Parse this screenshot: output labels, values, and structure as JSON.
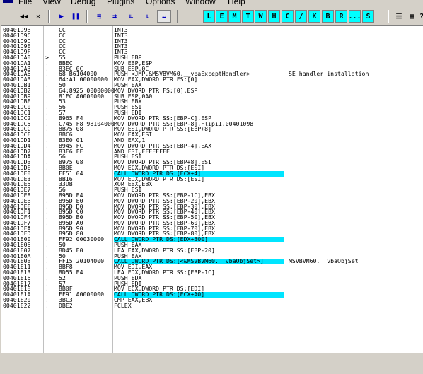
{
  "menu": [
    "File",
    "View",
    "Debug",
    "Plugins",
    "Options",
    "Window",
    "Help"
  ],
  "toolbar": {
    "nav_buttons": [
      "◀◀",
      "✕"
    ],
    "run_buttons": [
      "▶",
      "❚❚"
    ],
    "step_buttons": [
      "⇶",
      "⇉",
      "⇊",
      "⇓",
      "↵"
    ],
    "letter_buttons": [
      "L",
      "E",
      "M",
      "T",
      "W",
      "H",
      "C",
      "/",
      "K",
      "B",
      "R",
      "...",
      "S"
    ],
    "view_buttons": [
      "☰",
      "▦",
      "?"
    ]
  },
  "disasm": [
    {
      "addr": "00401D9B",
      "mark": "",
      "hex": "CC",
      "asm": "INT3",
      "hl": false,
      "comment": ""
    },
    {
      "addr": "00401D9C",
      "mark": "",
      "hex": "CC",
      "asm": "INT3",
      "hl": false,
      "comment": ""
    },
    {
      "addr": "00401D9D",
      "mark": "",
      "hex": "CC",
      "asm": "INT3",
      "hl": false,
      "comment": ""
    },
    {
      "addr": "00401D9E",
      "mark": "",
      "hex": "CC",
      "asm": "INT3",
      "hl": false,
      "comment": ""
    },
    {
      "addr": "00401D9F",
      "mark": "",
      "hex": "CC",
      "asm": "INT3",
      "hl": false,
      "comment": ""
    },
    {
      "addr": "00401DA0",
      "mark": ">",
      "hex": "55",
      "asm": "PUSH EBP",
      "hl": false,
      "comment": ""
    },
    {
      "addr": "00401DA1",
      "mark": ".",
      "hex": "8BEC",
      "asm": "MOV EBP,ESP",
      "hl": false,
      "comment": ""
    },
    {
      "addr": "00401DA3",
      "mark": ".",
      "hex": "83EC 0C",
      "asm": "SUB ESP,0C",
      "hl": false,
      "comment": ""
    },
    {
      "addr": "00401DA6",
      "mark": ".",
      "hex": "68 B6104000",
      "asm": "PUSH <JMP.&MSVBVM60.__vbaExceptHandler>",
      "hl": false,
      "comment": "SE handler installation"
    },
    {
      "addr": "00401DAB",
      "mark": ".",
      "hex": "64:A1 00000000",
      "asm": "MOV EAX,DWORD PTR FS:[0]",
      "hl": false,
      "comment": ""
    },
    {
      "addr": "00401DB1",
      "mark": ".",
      "hex": "50",
      "asm": "PUSH EAX",
      "hl": false,
      "comment": ""
    },
    {
      "addr": "00401DB2",
      "mark": ".",
      "hex": "64:8925 00000000",
      "asm": "MOV DWORD PTR FS:[0],ESP",
      "hl": false,
      "comment": ""
    },
    {
      "addr": "00401DB9",
      "mark": ".",
      "hex": "81EC A0000000",
      "asm": "SUB ESP,0A0",
      "hl": false,
      "comment": ""
    },
    {
      "addr": "00401DBF",
      "mark": ".",
      "hex": "53",
      "asm": "PUSH EBX",
      "hl": false,
      "comment": ""
    },
    {
      "addr": "00401DC0",
      "mark": ".",
      "hex": "56",
      "asm": "PUSH ESI",
      "hl": false,
      "comment": ""
    },
    {
      "addr": "00401DC1",
      "mark": ".",
      "hex": "57",
      "asm": "PUSH EDI",
      "hl": false,
      "comment": ""
    },
    {
      "addr": "00401DC2",
      "mark": ".",
      "hex": "8965 F4",
      "asm": "MOV DWORD PTR SS:[EBP-C],ESP",
      "hl": false,
      "comment": ""
    },
    {
      "addr": "00401DC5",
      "mark": ".",
      "hex": "C745 F8 98104000",
      "asm": "MOV DWORD PTR SS:[EBP-8],Flipi1.00401098",
      "hl": false,
      "comment": ""
    },
    {
      "addr": "00401DCC",
      "mark": ".",
      "hex": "8B75 08",
      "asm": "MOV ESI,DWORD PTR SS:[EBP+8]",
      "hl": false,
      "comment": ""
    },
    {
      "addr": "00401DCF",
      "mark": ".",
      "hex": "8BC6",
      "asm": "MOV EAX,ESI",
      "hl": false,
      "comment": ""
    },
    {
      "addr": "00401DD1",
      "mark": ".",
      "hex": "83E0 01",
      "asm": "AND EAX,1",
      "hl": false,
      "comment": ""
    },
    {
      "addr": "00401DD4",
      "mark": ".",
      "hex": "8945 FC",
      "asm": "MOV DWORD PTR SS:[EBP-4],EAX",
      "hl": false,
      "comment": ""
    },
    {
      "addr": "00401DD7",
      "mark": ".",
      "hex": "83E6 FE",
      "asm": "AND ESI,FFFFFFFE",
      "hl": false,
      "comment": ""
    },
    {
      "addr": "00401DDA",
      "mark": ".",
      "hex": "56",
      "asm": "PUSH ESI",
      "hl": false,
      "comment": ""
    },
    {
      "addr": "00401DDB",
      "mark": ".",
      "hex": "8975 08",
      "asm": "MOV DWORD PTR SS:[EBP+8],ESI",
      "hl": false,
      "comment": ""
    },
    {
      "addr": "00401DDE",
      "mark": ".",
      "hex": "8B0E",
      "asm": "MOV ECX,DWORD PTR DS:[ESI]",
      "hl": false,
      "comment": ""
    },
    {
      "addr": "00401DE0",
      "mark": ".",
      "hex": "FF51 04",
      "asm": "CALL DWORD PTR DS:[ECX+4]",
      "hl": true,
      "comment": ""
    },
    {
      "addr": "00401DE3",
      "mark": ".",
      "hex": "8B16",
      "asm": "MOV EDX,DWORD PTR DS:[ESI]",
      "hl": false,
      "comment": ""
    },
    {
      "addr": "00401DE5",
      "mark": ".",
      "hex": "33DB",
      "asm": "XOR EBX,EBX",
      "hl": false,
      "comment": ""
    },
    {
      "addr": "00401DE7",
      "mark": ".",
      "hex": "56",
      "asm": "PUSH ESI",
      "hl": false,
      "comment": ""
    },
    {
      "addr": "00401DE8",
      "mark": ".",
      "hex": "895D E4",
      "asm": "MOV DWORD PTR SS:[EBP-1C],EBX",
      "hl": false,
      "comment": ""
    },
    {
      "addr": "00401DEB",
      "mark": ".",
      "hex": "895D E0",
      "asm": "MOV DWORD PTR SS:[EBP-20],EBX",
      "hl": false,
      "comment": ""
    },
    {
      "addr": "00401DEE",
      "mark": ".",
      "hex": "895D D0",
      "asm": "MOV DWORD PTR SS:[EBP-30],EBX",
      "hl": false,
      "comment": ""
    },
    {
      "addr": "00401DF1",
      "mark": ".",
      "hex": "895D C0",
      "asm": "MOV DWORD PTR SS:[EBP-40],EBX",
      "hl": false,
      "comment": ""
    },
    {
      "addr": "00401DF4",
      "mark": ".",
      "hex": "895D B0",
      "asm": "MOV DWORD PTR SS:[EBP-50],EBX",
      "hl": false,
      "comment": ""
    },
    {
      "addr": "00401DF7",
      "mark": ".",
      "hex": "895D A0",
      "asm": "MOV DWORD PTR SS:[EBP-60],EBX",
      "hl": false,
      "comment": ""
    },
    {
      "addr": "00401DFA",
      "mark": ".",
      "hex": "895D 90",
      "asm": "MOV DWORD PTR SS:[EBP-70],EBX",
      "hl": false,
      "comment": ""
    },
    {
      "addr": "00401DFD",
      "mark": ".",
      "hex": "895D 80",
      "asm": "MOV DWORD PTR SS:[EBP-80],EBX",
      "hl": false,
      "comment": ""
    },
    {
      "addr": "00401E00",
      "mark": ".",
      "hex": "FF92 00030000",
      "asm": "CALL DWORD PTR DS:[EDX+300]",
      "hl": true,
      "comment": ""
    },
    {
      "addr": "00401E06",
      "mark": ".",
      "hex": "50",
      "asm": "PUSH EAX",
      "hl": false,
      "comment": ""
    },
    {
      "addr": "00401E07",
      "mark": ".",
      "hex": "8D45 E0",
      "asm": "LEA EAX,DWORD PTR SS:[EBP-20]",
      "hl": false,
      "comment": ""
    },
    {
      "addr": "00401E0A",
      "mark": ".",
      "hex": "50",
      "asm": "PUSH EAX",
      "hl": false,
      "comment": ""
    },
    {
      "addr": "00401E0B",
      "mark": ".",
      "hex": "FF15 20104000",
      "asm": "CALL DWORD PTR DS:[<&MSVBVM60.__vbaObjSet>]",
      "hl": true,
      "comment": "MSVBVM60.__vbaObjSet"
    },
    {
      "addr": "00401E11",
      "mark": ".",
      "hex": "8BF8",
      "asm": "MOV EDI,EAX",
      "hl": false,
      "comment": ""
    },
    {
      "addr": "00401E13",
      "mark": ".",
      "hex": "8D55 E4",
      "asm": "LEA EDX,DWORD PTR SS:[EBP-1C]",
      "hl": false,
      "comment": ""
    },
    {
      "addr": "00401E16",
      "mark": ".",
      "hex": "52",
      "asm": "PUSH EDX",
      "hl": false,
      "comment": ""
    },
    {
      "addr": "00401E17",
      "mark": ".",
      "hex": "57",
      "asm": "PUSH EDI",
      "hl": false,
      "comment": ""
    },
    {
      "addr": "00401E18",
      "mark": ".",
      "hex": "8B0F",
      "asm": "MOV ECX,DWORD PTR DS:[EDI]",
      "hl": false,
      "comment": ""
    },
    {
      "addr": "00401E1A",
      "mark": ".",
      "hex": "FF91 A0000000",
      "asm": "CALL DWORD PTR DS:[ECX+A0]",
      "hl": true,
      "comment": ""
    },
    {
      "addr": "00401E20",
      "mark": ".",
      "hex": "3BC3",
      "asm": "CMP EAX,EBX",
      "hl": false,
      "comment": ""
    },
    {
      "addr": "00401E22",
      "mark": ".",
      "hex": "DBE2",
      "asm": "FCLEX",
      "hl": false,
      "comment": ""
    }
  ]
}
